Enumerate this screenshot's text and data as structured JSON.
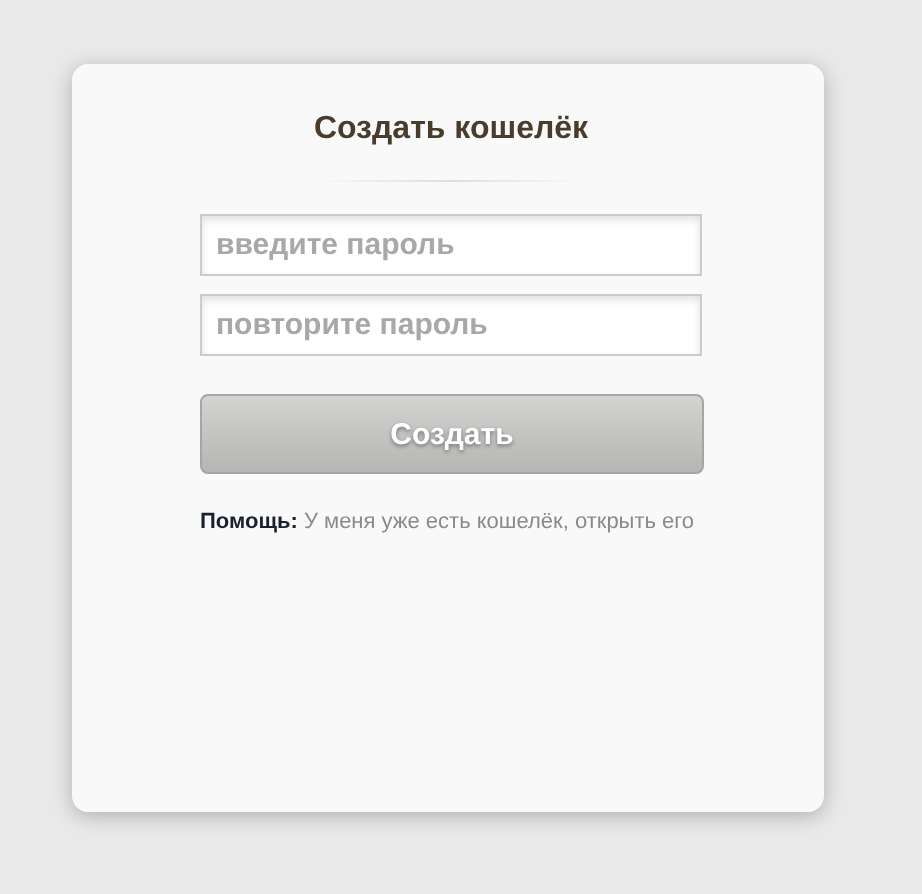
{
  "title": "Создать кошелёк",
  "fields": [
    {
      "placeholder": "введите пароль"
    },
    {
      "placeholder": "повторите пароль"
    }
  ],
  "button": "Создать",
  "help": "**Помощь:** У меня уже есть кошелёк, открыть его"
}
